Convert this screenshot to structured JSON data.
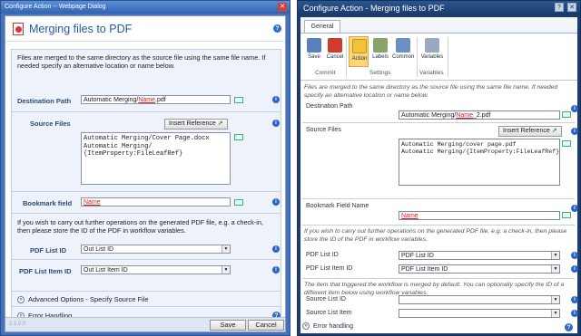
{
  "left": {
    "window_title": "Configure Action -- Webpage Dialog",
    "heading": "Merging files to PDF",
    "intro": "Files are merged to the same directory as the source file using the same file name. If needed specify an alternative location or name below.",
    "destination": {
      "label": "Destination Path",
      "value_prefix": "Automatic Merging/",
      "value_token": "Name",
      "value_suffix": ".pdf"
    },
    "source": {
      "label": "Source Files",
      "insert_reference": "Insert Reference",
      "lines": "Automatic Merging/Cover Page.docx\nAutomatic Merging/\n{ItemProperty:FileLeafRef}"
    },
    "bookmark": {
      "label": "Bookmark field",
      "value_token": "Name"
    },
    "note": "If you wish to carry out further operations on the generated PDF file, e.g. a check-in, then please store the ID of the PDF in workflow variables.",
    "pdf_list_id": {
      "label": "PDF List ID",
      "value": "Out List ID"
    },
    "pdf_list_item_id": {
      "label": "PDF List Item ID",
      "value": "Out List Item ID"
    },
    "advanced": "Advanced Options - Specify Source File",
    "error_handling": "Error Handling",
    "save": "Save",
    "cancel": "Cancel",
    "footnote": "2.1.0.0"
  },
  "right": {
    "window_title": "Configure Action - Merging files to PDF",
    "tab": "General",
    "ribbon": {
      "buttons": [
        {
          "label": "Save",
          "icon": "save-icon"
        },
        {
          "label": "Cancel",
          "icon": "cancel-icon"
        },
        {
          "label": "Action",
          "icon": "action-icon"
        },
        {
          "label": "Labels",
          "icon": "labels-icon"
        },
        {
          "label": "Common",
          "icon": "common-icon"
        },
        {
          "label": "Variables",
          "icon": "variables-icon"
        }
      ],
      "groups": [
        "Commit",
        "Settings",
        "Variables"
      ]
    },
    "intro": "Files are merged to the same directory as the source file using the same file name. If needed specify an alternative location or name below.",
    "destination": {
      "label": "Destination Path",
      "value_prefix": "Automatic Merging/",
      "value_token": "Name",
      "value_suffix": "_2.pdf"
    },
    "source": {
      "label": "Source Files",
      "insert_reference": "Insert Reference",
      "lines": "Automatic Merging/cover page.pdf\nAutomatic Merging/{ItemProperty:FileLeafRef}"
    },
    "bookmark": {
      "label": "Bookmark Field Name",
      "value_token": "Name"
    },
    "note": "If you wish to carry out further operations on the generated PDF file, e.g. a check-in, then please store the ID of the PDF in workflow variables.",
    "pdf_list_id": {
      "label": "PDF List ID",
      "value": "PDF List ID"
    },
    "pdf_list_item_id": {
      "label": "PDF List Item ID",
      "value": "PDF List Item ID"
    },
    "note2": "The item that triggered the workflow is merged by default. You can optionally specify the ID of a different item below using workflow variables.",
    "source_list_id": {
      "label": "Source List ID",
      "value": ""
    },
    "source_list_item": {
      "label": "Source List Item",
      "value": ""
    },
    "error_handling": "Error handling"
  }
}
